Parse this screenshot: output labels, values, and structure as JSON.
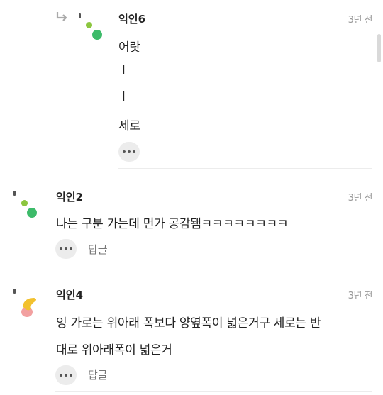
{
  "comments": [
    {
      "author": "익인6",
      "time": "3년 전",
      "lines": [
        "어랏",
        "l",
        "l",
        "세로"
      ],
      "more_label": "more-options",
      "is_reply": true,
      "avatar_colors": [
        "#8cc63f",
        "#3dbb6a"
      ]
    },
    {
      "author": "익인2",
      "time": "3년 전",
      "lines": [
        "나는 구분 가는데 먼가 공감됌ㅋㅋㅋㅋㅋㅋㅋㅋ"
      ],
      "reply_label": "답글",
      "avatar_colors": [
        "#8cc63f",
        "#3dbb6a"
      ]
    },
    {
      "author": "익인4",
      "time": "3년 전",
      "lines": [
        "잉 가로는 위아래 폭보다 양옆폭이 넓은거구 세로는 반",
        "대로 위아래폭이 넓은거"
      ],
      "reply_label": "답글",
      "avatar_colors": [
        "#f2c12e",
        "#f2a0a0"
      ]
    }
  ]
}
